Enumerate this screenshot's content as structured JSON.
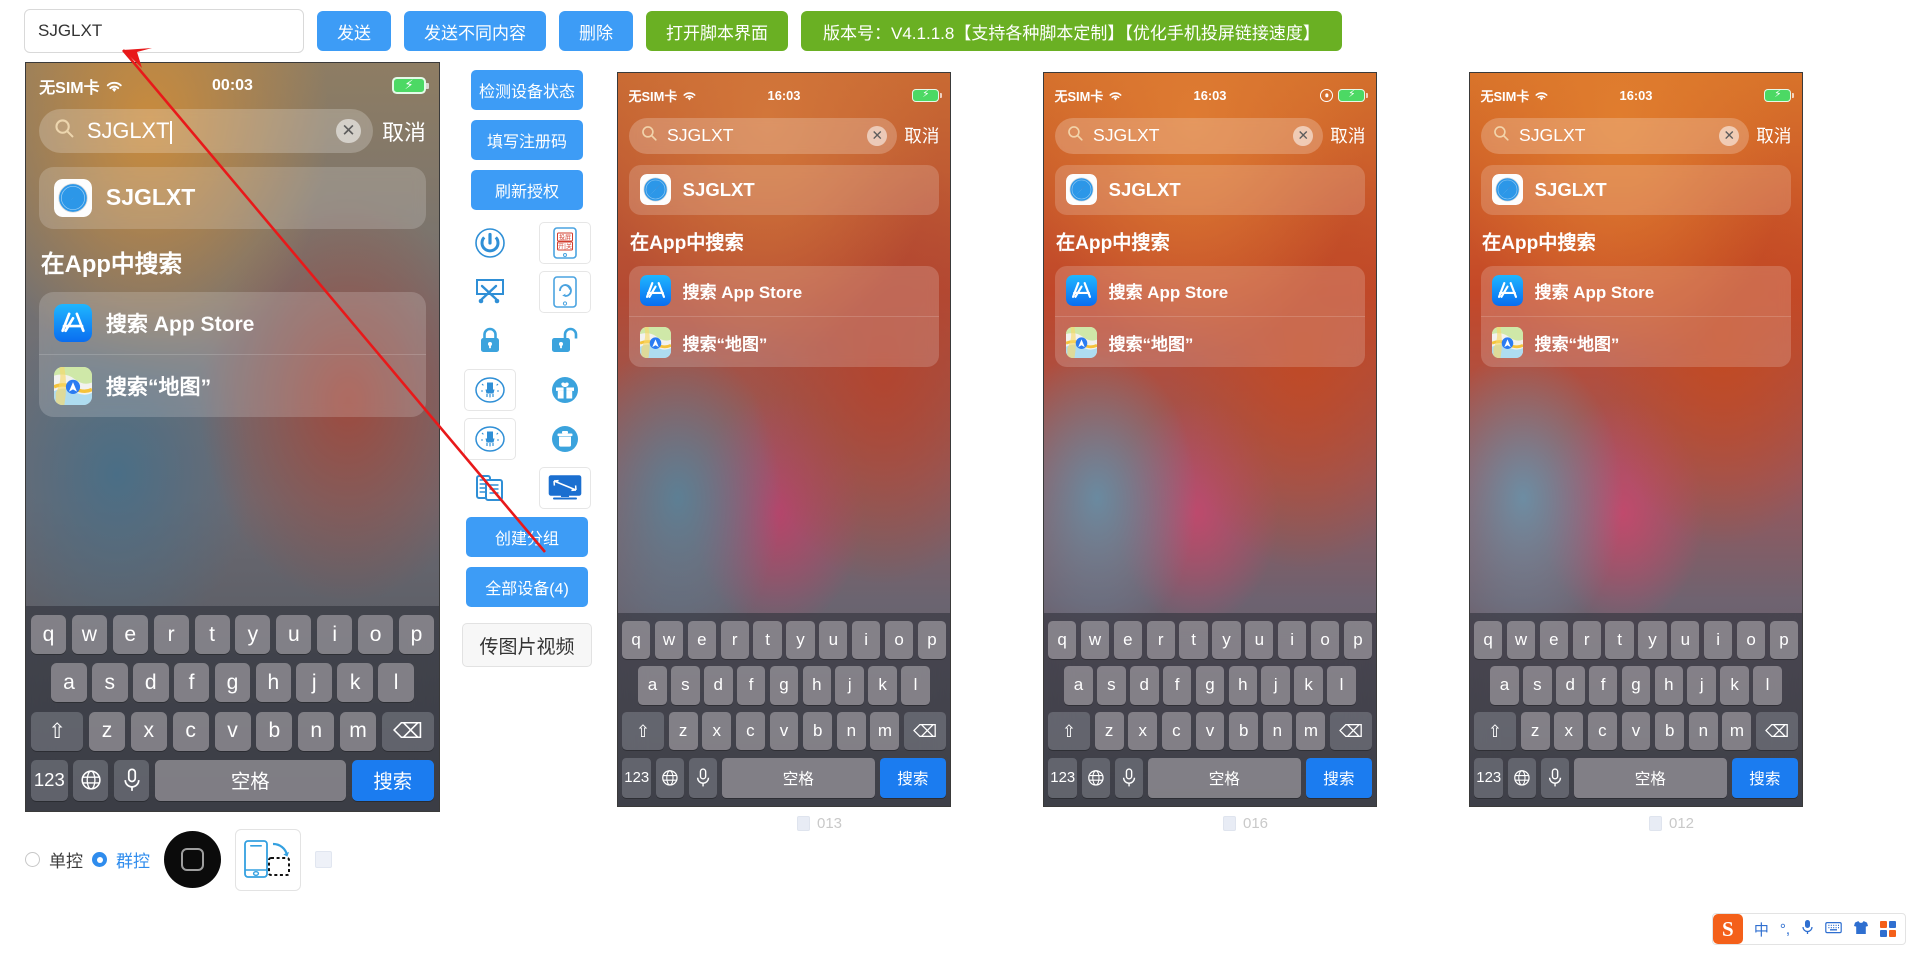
{
  "toolbar": {
    "input_value": "SJGLXT",
    "input_placeholder": "",
    "buttons": [
      {
        "label": "发送",
        "color": "#3d9cf6"
      },
      {
        "label": "发送不同内容",
        "color": "#3d9cf6"
      },
      {
        "label": "删除",
        "color": "#3d9cf6"
      },
      {
        "label": "打开脚本界面",
        "color": "#6ab023"
      }
    ],
    "version_banner": "版本号：V4.1.1.8【支持各种脚本定制】【优化手机投屏链接速度】"
  },
  "panel": {
    "buttons_top": [
      "检测设备状态",
      "填写注册码",
      "刷新授权"
    ],
    "icons": [
      {
        "name": "power-icon",
        "label": "电源"
      },
      {
        "name": "screencast-toggle-icon",
        "label": "投屏开关"
      },
      {
        "name": "disconnect-icon",
        "label": "断开连接"
      },
      {
        "name": "refresh-device-icon",
        "label": "刷新设备"
      },
      {
        "name": "lock-closed-icon",
        "label": "锁定"
      },
      {
        "name": "lock-open-icon",
        "label": "解锁"
      },
      {
        "name": "clean-icon-1",
        "label": "清理"
      },
      {
        "name": "gift-icon",
        "label": "礼物"
      },
      {
        "name": "clean-icon-2",
        "label": "清理2"
      },
      {
        "name": "trash-icon",
        "label": "删除"
      },
      {
        "name": "copy-icon",
        "label": "复制"
      },
      {
        "name": "screen-resize-icon",
        "label": "屏幕"
      }
    ],
    "screencast_icon_text": [
      "投屏",
      "开|关"
    ],
    "buttons_bottom": [
      "创建分组",
      "全部设备(4)"
    ],
    "ghost_button": "传图片视频"
  },
  "bottom_bar": {
    "radio_single": "单控",
    "radio_group": "群控",
    "selected": "群控",
    "home_button": "home-button",
    "rotate_button": "rotate-screen"
  },
  "taskbar": {
    "logo": "S",
    "items": [
      "中",
      "°,",
      "mic",
      "keyboard",
      "skin",
      "grid"
    ]
  },
  "phones": [
    {
      "id": "phone-1",
      "device_label": "",
      "status": {
        "carrier": "无SIM卡",
        "time": "00:03",
        "has_lock_icon": false,
        "battery": "charging"
      },
      "search": {
        "value": "SJGLXT",
        "has_caret": true,
        "cancel": "取消"
      },
      "result": {
        "app": "SJGLXT",
        "icon": "safari-icon"
      },
      "section_title": "在App中搜索",
      "app_searches": [
        {
          "label": "搜索 App Store",
          "icon": "appstore-icon"
        },
        {
          "label": "搜索“地图”",
          "icon": "maps-icon"
        }
      ],
      "keyboard": {
        "row1": [
          "q",
          "w",
          "e",
          "r",
          "t",
          "y",
          "u",
          "i",
          "o",
          "p"
        ],
        "row2": [
          "a",
          "s",
          "d",
          "f",
          "g",
          "h",
          "j",
          "k",
          "l"
        ],
        "row3": [
          "z",
          "x",
          "c",
          "v",
          "b",
          "n",
          "m"
        ],
        "shift": "⇧",
        "backspace": "⌫",
        "numeric": "123",
        "globe": "🌐",
        "mic": "mic",
        "space": "空格",
        "go": "搜索"
      }
    },
    {
      "id": "phone-2",
      "device_label": "013",
      "status": {
        "carrier": "无SIM卡",
        "time": "16:03",
        "has_lock_icon": false,
        "battery": "charging"
      },
      "search": {
        "value": "SJGLXT",
        "has_caret": false,
        "cancel": "取消"
      },
      "result": {
        "app": "SJGLXT",
        "icon": "safari-icon"
      },
      "section_title": "在App中搜索",
      "app_searches": [
        {
          "label": "搜索 App Store",
          "icon": "appstore-icon"
        },
        {
          "label": "搜索“地图”",
          "icon": "maps-icon"
        }
      ],
      "keyboard": {
        "row1": [
          "q",
          "w",
          "e",
          "r",
          "t",
          "y",
          "u",
          "i",
          "o",
          "p"
        ],
        "row2": [
          "a",
          "s",
          "d",
          "f",
          "g",
          "h",
          "j",
          "k",
          "l"
        ],
        "row3": [
          "z",
          "x",
          "c",
          "v",
          "b",
          "n",
          "m"
        ],
        "shift": "⇧",
        "backspace": "⌫",
        "numeric": "123",
        "globe": "🌐",
        "mic": "mic",
        "space": "空格",
        "go": "搜索"
      }
    },
    {
      "id": "phone-3",
      "device_label": "016",
      "status": {
        "carrier": "无SIM卡",
        "time": "16:03",
        "has_lock_icon": true,
        "battery": "charging"
      },
      "search": {
        "value": "SJGLXT",
        "has_caret": false,
        "cancel": "取消"
      },
      "result": {
        "app": "SJGLXT",
        "icon": "safari-icon"
      },
      "section_title": "在App中搜索",
      "app_searches": [
        {
          "label": "搜索 App Store",
          "icon": "appstore-icon"
        },
        {
          "label": "搜索“地图”",
          "icon": "maps-icon"
        }
      ],
      "keyboard": {
        "row1": [
          "q",
          "w",
          "e",
          "r",
          "t",
          "y",
          "u",
          "i",
          "o",
          "p"
        ],
        "row2": [
          "a",
          "s",
          "d",
          "f",
          "g",
          "h",
          "j",
          "k",
          "l"
        ],
        "row3": [
          "z",
          "x",
          "c",
          "v",
          "b",
          "n",
          "m"
        ],
        "shift": "⇧",
        "backspace": "⌫",
        "numeric": "123",
        "globe": "🌐",
        "mic": "mic",
        "space": "空格",
        "go": "搜索"
      }
    },
    {
      "id": "phone-4",
      "device_label": "012",
      "status": {
        "carrier": "无SIM卡",
        "time": "16:03",
        "has_lock_icon": false,
        "battery": "charging"
      },
      "search": {
        "value": "SJGLXT",
        "has_caret": false,
        "cancel": "取消"
      },
      "result": {
        "app": "SJGLXT",
        "icon": "safari-icon"
      },
      "section_title": "在App中搜索",
      "app_searches": [
        {
          "label": "搜索 App Store",
          "icon": "appstore-icon"
        },
        {
          "label": "搜索“地图”",
          "icon": "maps-icon"
        }
      ],
      "keyboard": {
        "row1": [
          "q",
          "w",
          "e",
          "r",
          "t",
          "y",
          "u",
          "i",
          "o",
          "p"
        ],
        "row2": [
          "a",
          "s",
          "d",
          "f",
          "g",
          "h",
          "j",
          "k",
          "l"
        ],
        "row3": [
          "z",
          "x",
          "c",
          "v",
          "b",
          "n",
          "m"
        ],
        "shift": "⇧",
        "backspace": "⌫",
        "numeric": "123",
        "globe": "🌐",
        "mic": "mic",
        "space": "空格",
        "go": "搜索"
      }
    }
  ],
  "colors": {
    "accent_blue": "#3d9cf6",
    "accent_green": "#6ab023",
    "arrow_red": "#e8191a",
    "key_blue": "#1b7cf0"
  }
}
